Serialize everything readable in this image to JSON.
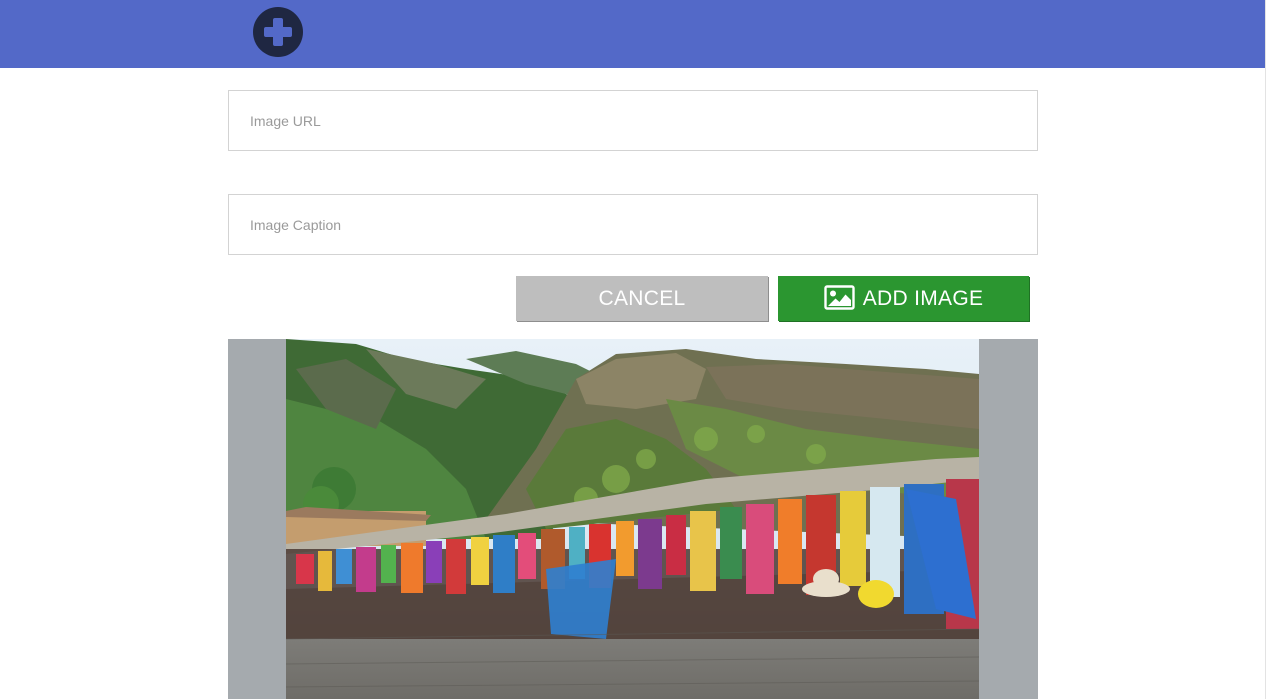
{
  "header": {
    "add_icon": "plus-circle-icon",
    "background_color": "#5369c8",
    "icon_color": "#1f2742"
  },
  "form": {
    "image_url": {
      "value": "",
      "placeholder": "Image URL"
    },
    "image_caption": {
      "value": "",
      "placeholder": "Image Caption"
    }
  },
  "buttons": {
    "cancel_label": "CANCEL",
    "add_image_label": "ADD IMAGE",
    "add_image_icon": "image-icon",
    "cancel_color": "#bebebe",
    "add_color": "#2b9630"
  },
  "preview": {
    "background_color": "#a5aaae"
  }
}
